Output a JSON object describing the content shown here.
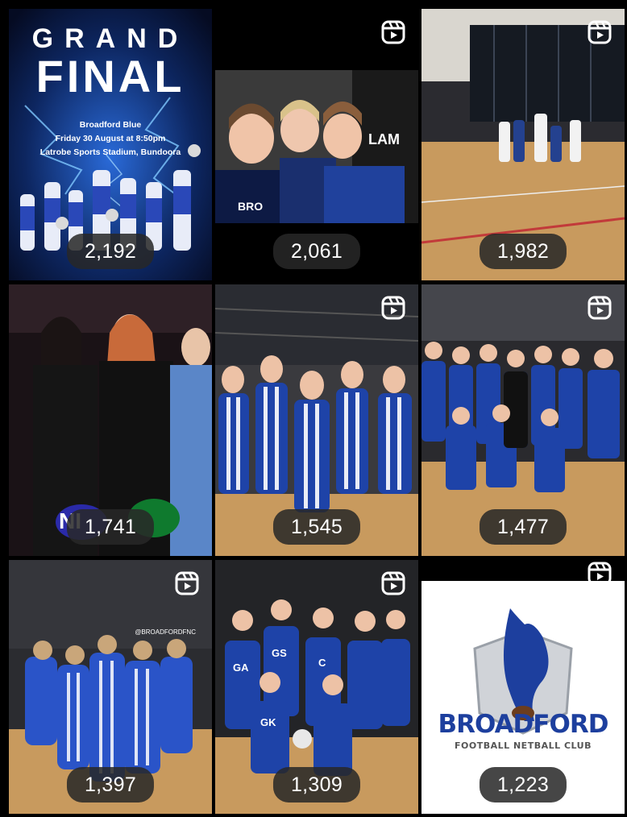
{
  "grid": {
    "tiles": [
      {
        "views": "2,192",
        "reel": false,
        "poster": {
          "title_top": "GRAND",
          "title_main": "FINAL",
          "line1": "Broadford Blue",
          "line2": "Friday 30 August at 8:50pm",
          "line3": "Latrobe Sports Stadium, Bundoora"
        }
      },
      {
        "views": "2,061",
        "reel": true,
        "sign": "LAM",
        "shirt": "BRO"
      },
      {
        "views": "1,982",
        "reel": true
      },
      {
        "views": "1,741",
        "reel": false,
        "sponsor": "NI"
      },
      {
        "views": "1,545",
        "reel": true
      },
      {
        "views": "1,477",
        "reel": true
      },
      {
        "views": "1,397",
        "reel": true,
        "watermark": "@BROADFORDFNC"
      },
      {
        "views": "1,309",
        "reel": true,
        "bibs": [
          "GA",
          "GS",
          "C",
          "GK"
        ]
      },
      {
        "views": "1,223",
        "reel": true,
        "logo": {
          "name": "BROADFORD",
          "sub": "FOOTBALL NETBALL CLUB"
        }
      }
    ]
  },
  "colors": {
    "badge_bg": "#282828",
    "club_blue": "#1d3f9e",
    "court": "#c89a5e"
  }
}
